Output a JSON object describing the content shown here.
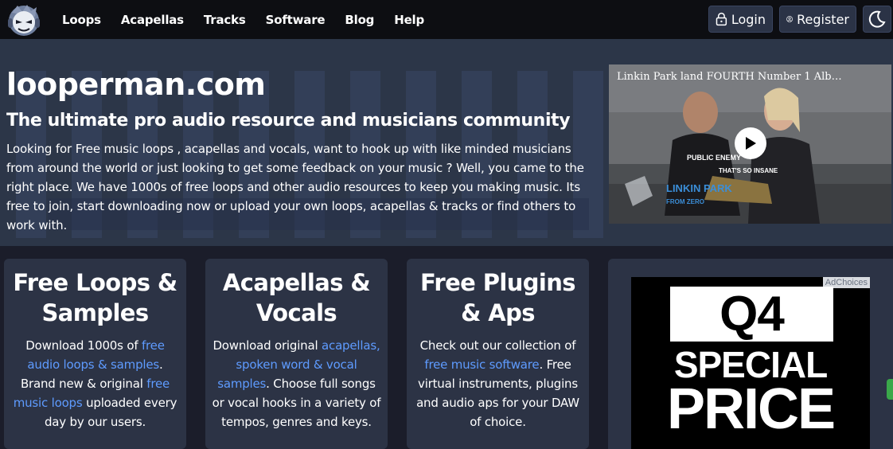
{
  "nav": {
    "logo_icon": "looperman-logo-icon",
    "links": [
      "Loops",
      "Acapellas",
      "Tracks",
      "Software",
      "Blog",
      "Help"
    ],
    "login_label": "Login",
    "register_label": "Register",
    "login_icon": "lock-icon",
    "register_icon": "user-circle-icon",
    "theme_icon": "moon-icon"
  },
  "hero": {
    "title": "looperman.com",
    "subtitle": "The ultimate pro audio resource and musicians community",
    "text": "Looking for Free music loops , acapellas and vocals, want to hook up with like minded musicians from around the world or just looking to get some feedback on your music ? Well, you came to the right place. We have 1000s of free loops and other audio resources to keep you making music. Its free to join, start downloading now or upload your own loops, acapellas & tracks or find others to work with."
  },
  "video": {
    "title": "Linkin Park land FOURTH Number 1 Alb…",
    "shirt_text": "PUBLIC ENEMY",
    "caption": "THAT'S SO INSANE",
    "band": "LINKIN PARK",
    "band_sub": "FROM ZERO"
  },
  "cards": [
    {
      "title": "Free Loops & Samples",
      "text_1": "Download 1000s of ",
      "link_1": "free audio loops & samples",
      "text_2": ". Brand new & original ",
      "link_2": "free music loops",
      "text_3": " uploaded every day by our users."
    },
    {
      "title": "Acapellas & Vocals",
      "text_1": "Download original ",
      "link_1": "acapellas, spoken word & vocal samples",
      "text_2": ". Choose full songs or vocal hooks in a variety of tempos, genres and keys."
    },
    {
      "title": "Free Plugins & Aps",
      "text_1": "Check out our collection of ",
      "link_1": "free music software",
      "text_2": ". Free virtual instruments, plugins and audio aps for your DAW of choice."
    }
  ],
  "ad": {
    "adchoices": "AdChoices",
    "q4": "Q4",
    "special": "SPECIAL",
    "price": "PRICE"
  },
  "colors": {
    "nav_bg": "#0d0e12",
    "hero_bg": "#2c3648",
    "page_bg": "#1b1d2a",
    "card_bg": "#2c3345",
    "link": "#5e9bff"
  }
}
